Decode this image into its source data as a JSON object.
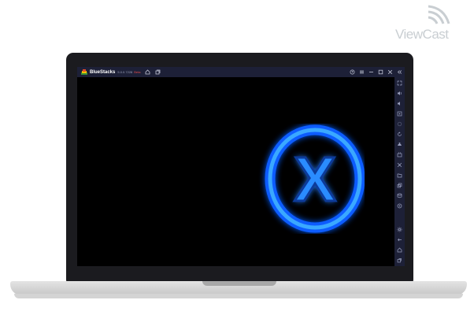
{
  "watermark": {
    "text": "ViewCast"
  },
  "titlebar": {
    "app_name": "BlueStacks",
    "version": "5.0.0.7228",
    "beta_label": "Beta"
  },
  "side_toolbar": {
    "icons": [
      "fullscreen-icon",
      "volume-up-icon",
      "volume-down-icon",
      "screen-record-icon",
      "keyboard-controls-icon",
      "rotate-icon",
      "shake-icon",
      "screenshot-icon",
      "eco-mode-icon",
      "folder-icon",
      "multi-instance-icon",
      "macro-icon",
      "location-icon",
      "settings-icon",
      "back-icon",
      "home-icon",
      "recent-apps-icon"
    ]
  },
  "app": {
    "logo_letter": "X",
    "accent_color": "#1e8cff"
  },
  "colors": {
    "titlebar": "#1d2037",
    "screen": "#000000",
    "bezel": "#1b1b1f"
  }
}
